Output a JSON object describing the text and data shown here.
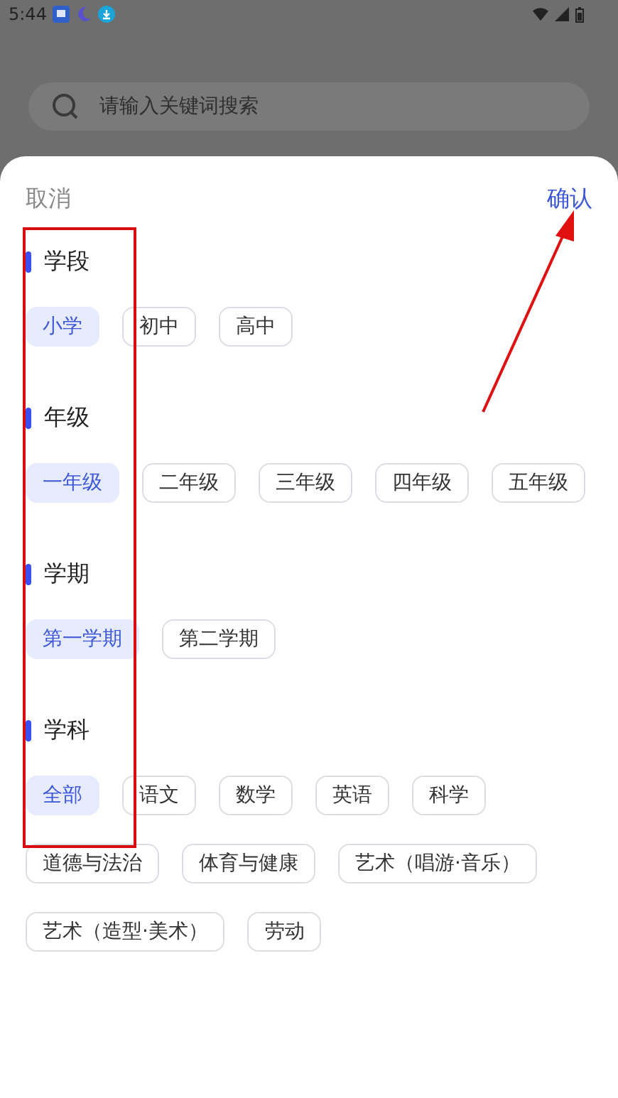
{
  "status_bar": {
    "time": "5:44"
  },
  "search": {
    "placeholder": "请输入关键词搜索"
  },
  "sheet": {
    "cancel": "取消",
    "confirm": "确认",
    "sections": [
      {
        "title": "学段",
        "options": [
          {
            "label": "小学",
            "selected": true
          },
          {
            "label": "初中",
            "selected": false
          },
          {
            "label": "高中",
            "selected": false
          }
        ]
      },
      {
        "title": "年级",
        "options": [
          {
            "label": "一年级",
            "selected": true
          },
          {
            "label": "二年级",
            "selected": false
          },
          {
            "label": "三年级",
            "selected": false
          },
          {
            "label": "四年级",
            "selected": false
          },
          {
            "label": "五年级",
            "selected": false
          }
        ]
      },
      {
        "title": "学期",
        "options": [
          {
            "label": "第一学期",
            "selected": true
          },
          {
            "label": "第二学期",
            "selected": false
          }
        ]
      },
      {
        "title": "学科",
        "options": [
          {
            "label": "全部",
            "selected": true
          },
          {
            "label": "语文",
            "selected": false
          },
          {
            "label": "数学",
            "selected": false
          },
          {
            "label": "英语",
            "selected": false
          },
          {
            "label": "科学",
            "selected": false
          },
          {
            "label": "道德与法治",
            "selected": false
          },
          {
            "label": "体育与健康",
            "selected": false
          },
          {
            "label": "艺术（唱游·音乐）",
            "selected": false
          },
          {
            "label": "艺术（造型·美术）",
            "selected": false
          },
          {
            "label": "劳动",
            "selected": false
          }
        ]
      }
    ]
  },
  "annotations": {
    "highlight_box": true,
    "arrow_to_confirm": true
  }
}
